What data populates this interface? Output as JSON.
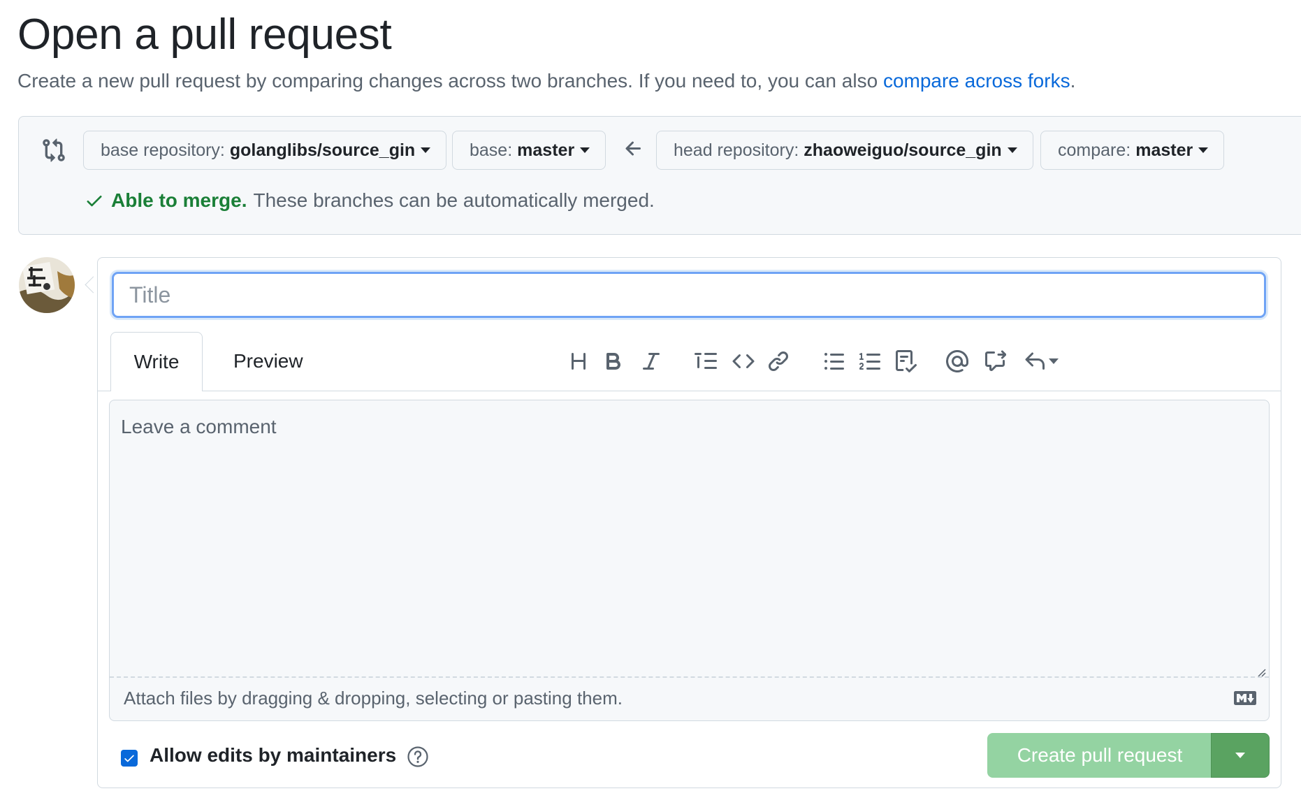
{
  "header": {
    "title": "Open a pull request",
    "subtitle_prefix": "Create a new pull request by comparing changes across two branches. If you need to, you can also ",
    "subtitle_link": "compare across forks",
    "subtitle_suffix": "."
  },
  "range": {
    "base_repository": {
      "label": "base repository:",
      "value": "golanglibs/source_gin"
    },
    "base": {
      "label": "base:",
      "value": "master"
    },
    "head_repository": {
      "label": "head repository:",
      "value": "zhaoweiguo/source_gin"
    },
    "compare": {
      "label": "compare:",
      "value": "master"
    },
    "merge_status_ok": "Able to merge.",
    "merge_status_text": "These branches can be automatically merged."
  },
  "form": {
    "title_placeholder": "Title",
    "tabs": [
      {
        "label": "Write"
      },
      {
        "label": "Preview"
      }
    ],
    "toolbar_icons": [
      "heading-icon",
      "bold-icon",
      "italic-icon",
      "quote-icon",
      "code-icon",
      "link-icon",
      "bulleted-list-icon",
      "numbered-list-icon",
      "task-list-icon",
      "mention-icon",
      "cross-reference-icon",
      "reply-icon"
    ],
    "comment_placeholder": "Leave a comment",
    "attach_text": "Attach files by dragging & dropping, selecting or pasting them.",
    "allow_edits_label": "Allow edits by maintainers",
    "allow_edits_checked": true,
    "create_button_label": "Create pull request"
  },
  "colors": {
    "link": "#0969da",
    "success": "#1a7f37",
    "create_button_disabled": "#94d3a2",
    "create_caret": "#5aa361",
    "focus_border": "#6fa3f5"
  }
}
